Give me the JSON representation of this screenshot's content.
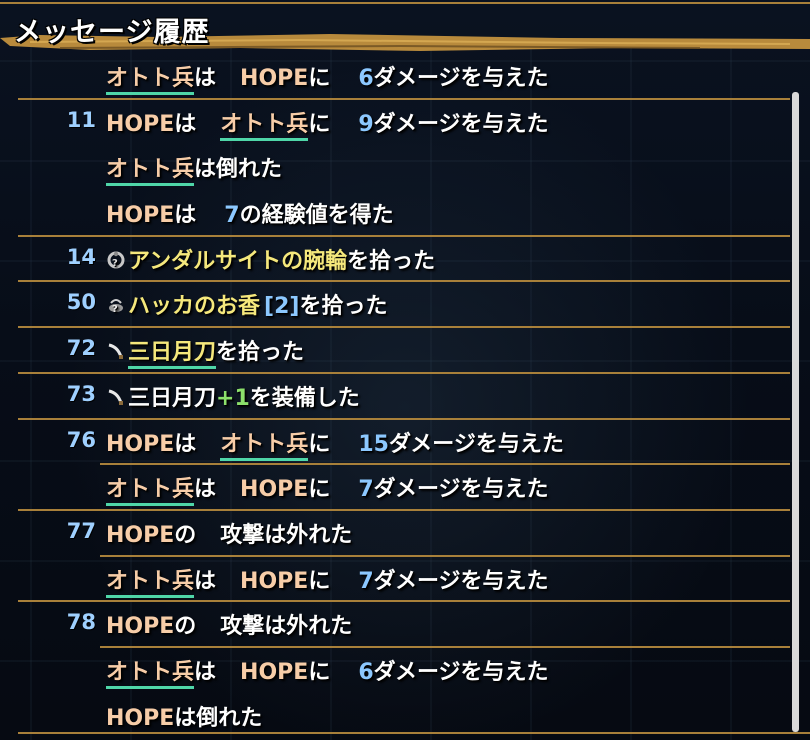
{
  "header": {
    "title": "メッセージ履歴"
  },
  "rows": [
    {
      "turn": "",
      "sep": "full",
      "parts": [
        [
          "enemy",
          "オトト兵"
        ],
        [
          "text",
          "は"
        ],
        [
          "gap",
          ""
        ],
        [
          "name",
          "HOPE"
        ],
        [
          "text",
          "に"
        ],
        [
          "gap",
          ""
        ],
        [
          "num",
          "6"
        ],
        [
          "text",
          "ダメージを与えた"
        ]
      ]
    },
    {
      "turn": "11",
      "sep": "none",
      "parts": [
        [
          "name",
          "HOPE"
        ],
        [
          "text",
          "は"
        ],
        [
          "gap",
          ""
        ],
        [
          "enemy",
          "オトト兵"
        ],
        [
          "text",
          "に"
        ],
        [
          "gap",
          ""
        ],
        [
          "num",
          "9"
        ],
        [
          "text",
          "ダメージを与えた"
        ]
      ]
    },
    {
      "turn": "",
      "sep": "none",
      "parts": [
        [
          "enemy",
          "オトト兵"
        ],
        [
          "text",
          "は倒れた"
        ]
      ]
    },
    {
      "turn": "",
      "sep": "full",
      "parts": [
        [
          "name",
          "HOPE"
        ],
        [
          "text",
          "は"
        ],
        [
          "gap",
          ""
        ],
        [
          "num",
          "7"
        ],
        [
          "text",
          "の経験値を得た"
        ]
      ]
    },
    {
      "turn": "14",
      "sep": "full",
      "parts": [
        [
          "icon",
          "bracelet-icon"
        ],
        [
          "item",
          "アンダルサイトの腕輪"
        ],
        [
          "text",
          "を拾った"
        ]
      ]
    },
    {
      "turn": "50",
      "sep": "full",
      "parts": [
        [
          "icon",
          "incense-icon"
        ],
        [
          "item",
          "ハッカのお香"
        ],
        [
          "num",
          "[2]"
        ],
        [
          "text",
          "を拾った"
        ]
      ]
    },
    {
      "turn": "72",
      "sep": "full",
      "parts": [
        [
          "icon",
          "sword-icon"
        ],
        [
          "itemul",
          "三日月刀"
        ],
        [
          "text",
          "を拾った"
        ]
      ]
    },
    {
      "turn": "73",
      "sep": "full",
      "parts": [
        [
          "icon",
          "sword-icon"
        ],
        [
          "text",
          "三日月刀"
        ],
        [
          "plus",
          "+1"
        ],
        [
          "text",
          "を装備した"
        ]
      ]
    },
    {
      "turn": "76",
      "sep": "indent",
      "parts": [
        [
          "name",
          "HOPE"
        ],
        [
          "text",
          "は"
        ],
        [
          "gap",
          ""
        ],
        [
          "enemy",
          "オトト兵"
        ],
        [
          "text",
          "に"
        ],
        [
          "gap",
          ""
        ],
        [
          "num",
          "15"
        ],
        [
          "text",
          "ダメージを与えた"
        ]
      ]
    },
    {
      "turn": "",
      "sep": "full",
      "parts": [
        [
          "enemy",
          "オトト兵"
        ],
        [
          "text",
          "は"
        ],
        [
          "gap",
          ""
        ],
        [
          "name",
          "HOPE"
        ],
        [
          "text",
          "に"
        ],
        [
          "gap",
          ""
        ],
        [
          "num",
          "7"
        ],
        [
          "text",
          "ダメージを与えた"
        ]
      ]
    },
    {
      "turn": "77",
      "sep": "indent",
      "parts": [
        [
          "name",
          "HOPE"
        ],
        [
          "text",
          "の"
        ],
        [
          "gap",
          ""
        ],
        [
          "text",
          "攻撃は外れた"
        ]
      ]
    },
    {
      "turn": "",
      "sep": "full",
      "parts": [
        [
          "enemy",
          "オトト兵"
        ],
        [
          "text",
          "は"
        ],
        [
          "gap",
          ""
        ],
        [
          "name",
          "HOPE"
        ],
        [
          "text",
          "に"
        ],
        [
          "gap",
          ""
        ],
        [
          "num",
          "7"
        ],
        [
          "text",
          "ダメージを与えた"
        ]
      ]
    },
    {
      "turn": "78",
      "sep": "indent",
      "parts": [
        [
          "name",
          "HOPE"
        ],
        [
          "text",
          "の"
        ],
        [
          "gap",
          ""
        ],
        [
          "text",
          "攻撃は外れた"
        ]
      ]
    },
    {
      "turn": "",
      "sep": "none",
      "parts": [
        [
          "enemy",
          "オトト兵"
        ],
        [
          "text",
          "は"
        ],
        [
          "gap",
          ""
        ],
        [
          "name",
          "HOPE"
        ],
        [
          "text",
          "に"
        ],
        [
          "gap",
          ""
        ],
        [
          "num",
          "6"
        ],
        [
          "text",
          "ダメージを与えた"
        ]
      ]
    },
    {
      "turn": "",
      "sep": "none",
      "parts": [
        [
          "name",
          "HOPE"
        ],
        [
          "text",
          "は倒れた"
        ]
      ]
    }
  ],
  "colors": {
    "accent_gold": "#a8803a",
    "name": "#f7cda8",
    "number": "#8cc8ff",
    "item": "#f5e87c",
    "enemy_underline": "#4fd6a8",
    "plus": "#8ce06b"
  }
}
